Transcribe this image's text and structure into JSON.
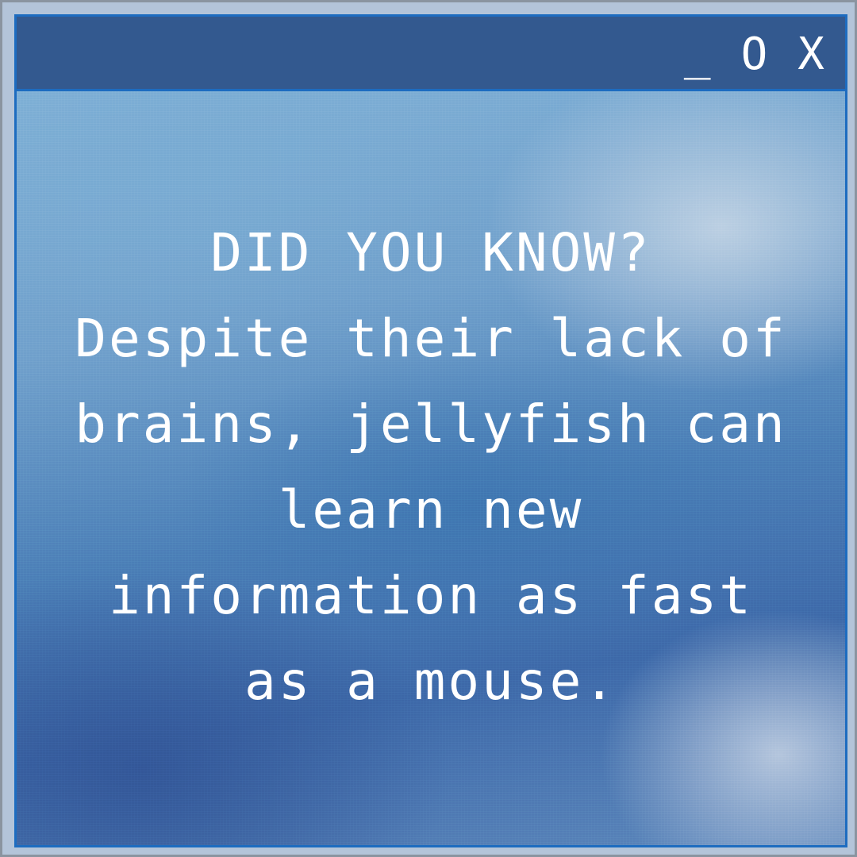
{
  "window": {
    "controls": {
      "minimize": "_",
      "maximize": "O",
      "close": "X"
    }
  },
  "message": {
    "lines": [
      "DID YOU KNOW?",
      "Despite their lack of",
      "brains, jellyfish can",
      "learn new",
      "information as fast",
      "as a mouse."
    ]
  },
  "colors": {
    "titlebar": "#33598f",
    "border": "#1d6cc0",
    "text": "#ffffff"
  }
}
